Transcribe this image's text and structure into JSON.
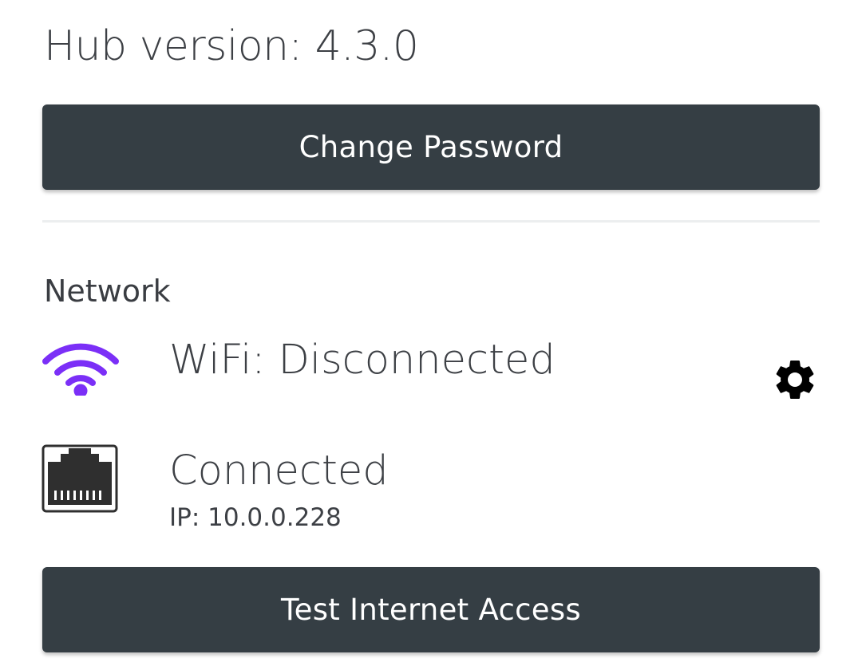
{
  "header": {
    "hub_version": "Hub version: 4.3.0"
  },
  "actions": {
    "change_password_label": "Change Password",
    "test_internet_label": "Test Internet Access"
  },
  "network": {
    "title": "Network",
    "wifi": {
      "status": "WiFi: Disconnected",
      "icon": "wifi-icon",
      "icon_color": "#7b2ff7",
      "settings_icon": "gear-icon"
    },
    "ethernet": {
      "status": "Connected",
      "ip": "IP: 10.0.0.228",
      "icon": "ethernet-port-icon"
    }
  },
  "colors": {
    "button_bg": "#353e44",
    "button_text": "#ffffff",
    "text": "#3d4045",
    "divider": "#eceeef"
  }
}
